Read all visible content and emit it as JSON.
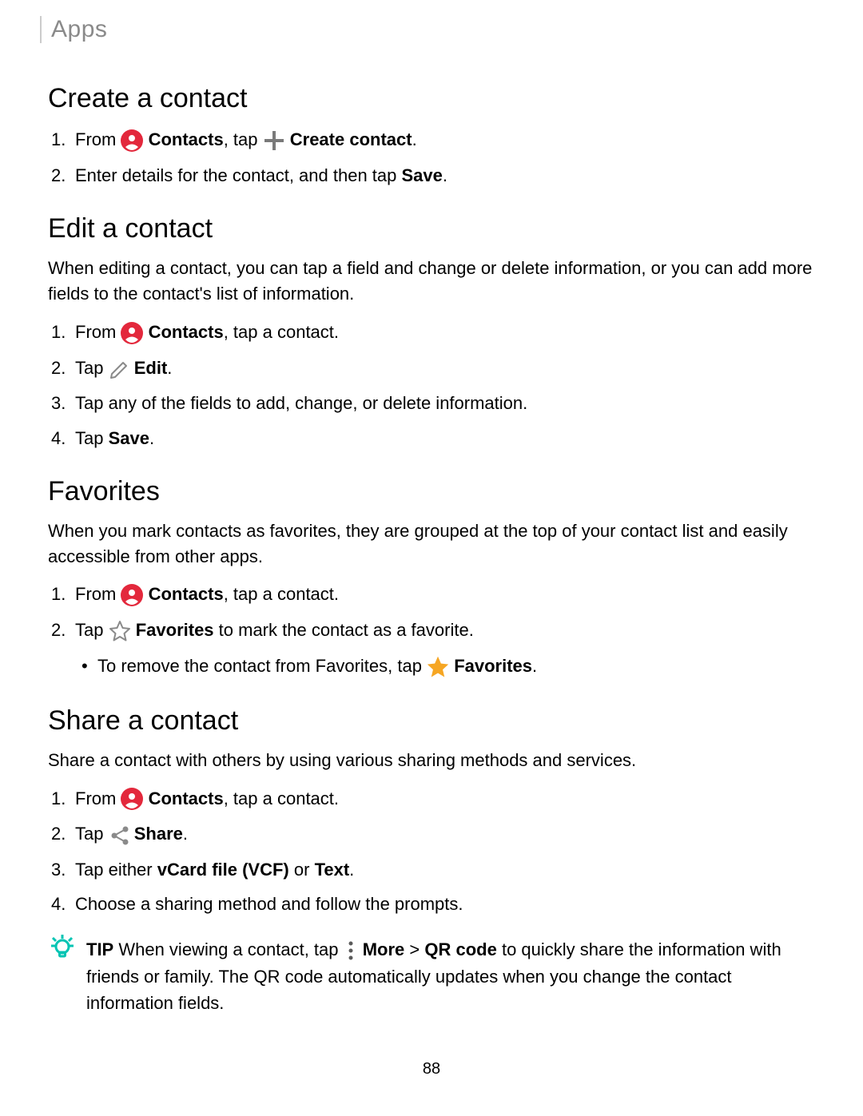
{
  "header": "Apps",
  "pageNum": "88",
  "icons": {
    "contacts": "contacts-icon",
    "plus": "plus-icon",
    "edit": "edit-icon",
    "starOutline": "star-outline-icon",
    "starFilled": "star-filled-icon",
    "share": "share-icon",
    "more": "more-icon",
    "tip": "tip-icon"
  },
  "sections": {
    "create": {
      "title": "Create a contact",
      "step1_pre": "From ",
      "step1_contacts": "Contacts",
      "step1_mid": ", tap ",
      "step1_createContact": "Create contact",
      "step1_end": ".",
      "step2_pre": "Enter details for the contact, and then tap ",
      "step2_save": "Save",
      "step2_end": "."
    },
    "edit": {
      "title": "Edit a contact",
      "intro": "When editing a contact, you can tap a field and change or delete information, or you can add more fields to the contact's list of information.",
      "step1_pre": "From ",
      "step1_contacts": "Contacts",
      "step1_end": ", tap a contact.",
      "step2_pre": "Tap ",
      "step2_edit": "Edit",
      "step2_end": ".",
      "step3": "Tap any of the fields to add, change, or delete information.",
      "step4_pre": "Tap ",
      "step4_save": "Save",
      "step4_end": "."
    },
    "favorites": {
      "title": "Favorites",
      "intro": "When you mark contacts as favorites, they are grouped at the top of your contact list and easily accessible from other apps.",
      "step1_pre": "From ",
      "step1_contacts": "Contacts",
      "step1_end": ", tap a contact.",
      "step2_pre": "Tap ",
      "step2_fav": "Favorites",
      "step2_post": " to mark the contact as a favorite.",
      "sub1_pre": "To remove the contact from Favorites, tap ",
      "sub1_fav": "Favorites",
      "sub1_end": "."
    },
    "share": {
      "title": "Share a contact",
      "intro": "Share a contact with others by using various sharing methods and services.",
      "step1_pre": "From ",
      "step1_contacts": "Contacts",
      "step1_end": ", tap a contact.",
      "step2_pre": "Tap ",
      "step2_share": "Share",
      "step2_end": ".",
      "step3_pre": "Tap either ",
      "step3_vcf": "vCard file (VCF)",
      "step3_or": " or ",
      "step3_text": "Text",
      "step3_end": ".",
      "step4": "Choose a sharing method and follow the prompts."
    },
    "tip": {
      "label": "TIP",
      "pre": "  When viewing a contact, tap ",
      "more": "More",
      "gt": " > ",
      "qr": "QR code",
      "post": " to quickly share the information with friends or family. The QR code automatically updates when you change the contact information fields."
    }
  }
}
